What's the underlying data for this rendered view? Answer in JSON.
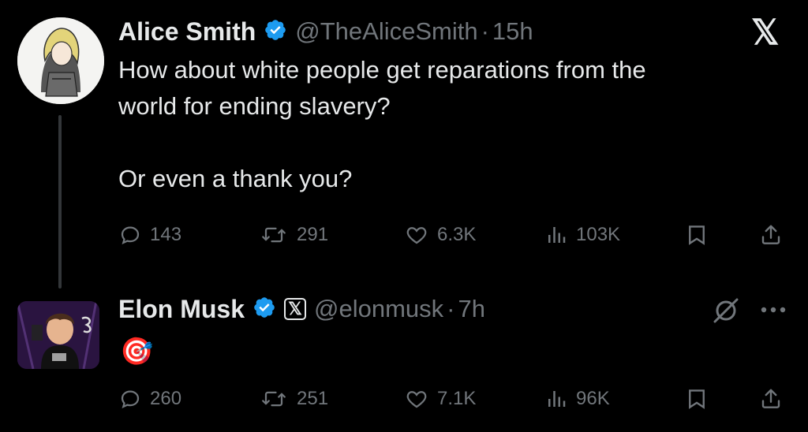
{
  "tweet1": {
    "name": "Alice Smith",
    "handle": "@TheAliceSmith",
    "time": "15h",
    "separator": "·",
    "text": "How about white people get reparations from the\nworld for ending slavery?\n\nOr even a thank you?",
    "replies": "143",
    "retweets": "291",
    "likes": "6.3K",
    "views": "103K"
  },
  "tweet2": {
    "name": "Elon Musk",
    "handle": "@elonmusk",
    "time": "7h",
    "separator": "·",
    "affiliate_badge": "𝕏",
    "text": "🎯",
    "replies": "260",
    "retweets": "251",
    "likes": "7.1K",
    "views": "96K"
  },
  "brand_logo": "𝕏",
  "colors": {
    "verified": "#1d9bf0",
    "muted": "#71767b",
    "text": "#e7e9ea",
    "background": "#000000"
  }
}
